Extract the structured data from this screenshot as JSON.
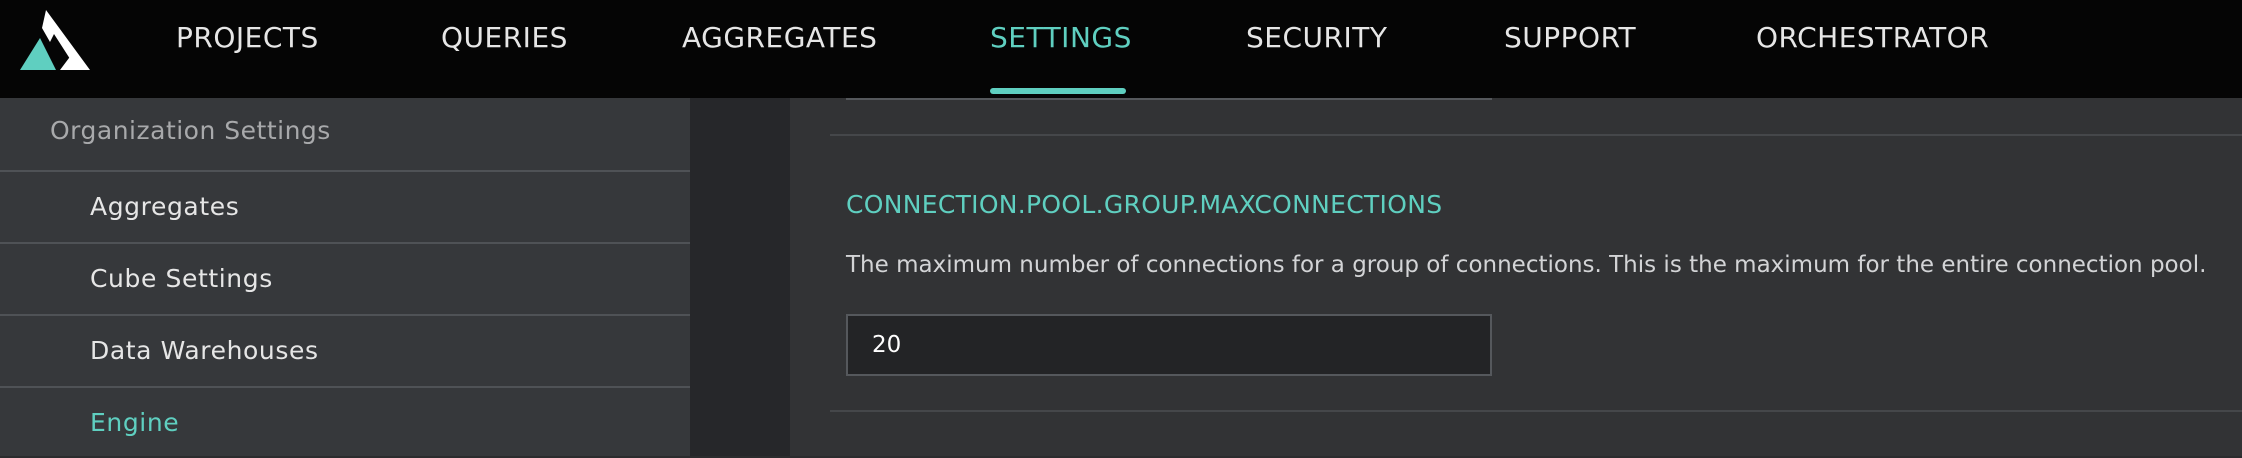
{
  "nav": {
    "items": [
      {
        "label": "PROJECTS",
        "active": false
      },
      {
        "label": "QUERIES",
        "active": false
      },
      {
        "label": "AGGREGATES",
        "active": false
      },
      {
        "label": "SETTINGS",
        "active": true
      },
      {
        "label": "SECURITY",
        "active": false
      },
      {
        "label": "SUPPORT",
        "active": false
      },
      {
        "label": "ORCHESTRATOR",
        "active": false
      }
    ],
    "logo_icon": "atscale-logo-icon"
  },
  "sidebar": {
    "header": "Organization Settings",
    "items": [
      {
        "label": "Aggregates",
        "active": false
      },
      {
        "label": "Cube Settings",
        "active": false
      },
      {
        "label": "Data Warehouses",
        "active": false
      },
      {
        "label": "Engine",
        "active": true
      }
    ]
  },
  "setting": {
    "title": "CONNECTION.POOL.GROUP.MAXCONNECTIONS",
    "description": "The maximum number of connections for a group of connections. This is the maximum for the entire connection pool.",
    "value": "20"
  },
  "colors": {
    "accent": "#5fcfc0",
    "topbar": "#050505",
    "sidebar": "#36383b",
    "content": "#323335"
  }
}
